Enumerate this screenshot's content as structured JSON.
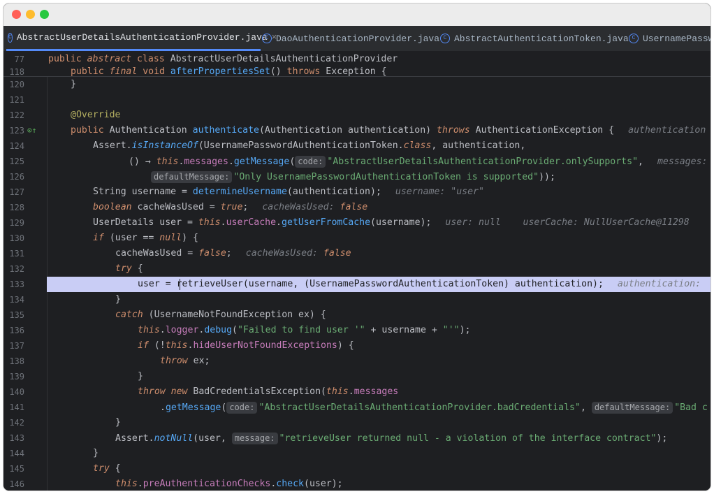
{
  "tabs": [
    {
      "label": "AbstractUserDetailsAuthenticationProvider.java",
      "active": true,
      "closable": true
    },
    {
      "label": "DaoAuthenticationProvider.java",
      "active": false
    },
    {
      "label": "AbstractAuthenticationToken.java",
      "active": false
    },
    {
      "label": "UsernamePasswo",
      "active": false
    }
  ],
  "colors": {
    "accent": "#548af7",
    "current_line": "#c9cdf5",
    "keyword": "#cf8e6d",
    "string": "#6aab73",
    "method": "#56a8f5",
    "field": "#c77dbb"
  },
  "sticky": {
    "line1_num": "77",
    "line1_text": "public abstract class AbstractUserDetailsAuthenticationProvider",
    "line2_num": "118",
    "line2_text": "public final void afterPropertiesSet() throws Exception {"
  },
  "lines": [
    {
      "num": "120"
    },
    {
      "num": "121"
    },
    {
      "num": "122"
    },
    {
      "num": "123"
    },
    {
      "num": "124"
    },
    {
      "num": "125"
    },
    {
      "num": "126"
    },
    {
      "num": "127"
    },
    {
      "num": "128"
    },
    {
      "num": "129"
    },
    {
      "num": "130"
    },
    {
      "num": "131"
    },
    {
      "num": "132"
    },
    {
      "num": "133"
    },
    {
      "num": "134"
    },
    {
      "num": "135"
    },
    {
      "num": "136"
    },
    {
      "num": "137"
    },
    {
      "num": "138"
    },
    {
      "num": "139"
    },
    {
      "num": "140"
    },
    {
      "num": "141"
    },
    {
      "num": "142"
    },
    {
      "num": "143"
    },
    {
      "num": "144"
    },
    {
      "num": "145"
    },
    {
      "num": "146"
    }
  ],
  "code": {
    "l120": "}",
    "l122_ann": "@Override",
    "l123_a": "public ",
    "l123_b": "Authentication ",
    "l123_fn": "authenticate",
    "l123_c": "(Authentication ",
    "l123_p": "authentication",
    "l123_d": ") ",
    "l123_kw": "throws ",
    "l123_e": "AuthenticationException {",
    "l123_hint": "authentication",
    "l124_a": "Assert.",
    "l124_fn": "isInstanceOf",
    "l124_b": "(UsernamePasswordAuthenticationToken.",
    "l124_kw": "class",
    "l124_c": ", authentication,",
    "l125_a": "() → ",
    "l125_kw": "this",
    "l125_b": ".",
    "l125_fld": "messages",
    "l125_c": ".",
    "l125_fn": "getMessage",
    "l125_d": "(",
    "l125_pn": "code:",
    "l125_str": "\"AbstractUserDetailsAuthenticationProvider.onlySupports\"",
    "l125_e": ",",
    "l125_hint": "messages: Me",
    "l126_pn": "defaultMessage:",
    "l126_str": "\"Only UsernamePasswordAuthenticationToken is supported\"",
    "l126_a": "));",
    "l127_a": "String username = ",
    "l127_fn": "determineUsername",
    "l127_b": "(authentication);",
    "l127_hint": "username: \"user\"",
    "l128_kw": "boolean ",
    "l128_a": "cacheWasUsed = ",
    "l128_kw2": "true",
    "l128_b": ";",
    "l128_hint": "cacheWasUsed: ",
    "l128_hintv": "false",
    "l129_a": "UserDetails user = ",
    "l129_kw": "this",
    "l129_b": ".",
    "l129_fld": "userCache",
    "l129_c": ".",
    "l129_fn": "getUserFromCache",
    "l129_d": "(username);",
    "l129_hint": "user: null    userCache: NullUserCache@11298",
    "l130_kw": "if ",
    "l130_a": "(user == ",
    "l130_kw2": "null",
    "l130_b": ") {",
    "l131_a": "cacheWasUsed = ",
    "l131_kw": "false",
    "l131_b": ";",
    "l131_hint": "cacheWasUsed: ",
    "l131_hintv": "false",
    "l132_kw": "try ",
    "l132_a": "{",
    "l133_a": "user = retrieveUser(username, (UsernamePasswordAuthenticationToken) authentication);",
    "l133_hint": "authentication:",
    "l134": "}",
    "l135_kw": "catch ",
    "l135_a": "(UsernameNotFoundException ex) {",
    "l136_kw": "this",
    "l136_a": ".",
    "l136_fld": "logger",
    "l136_b": ".",
    "l136_fn": "debug",
    "l136_c": "(",
    "l136_str": "\"Failed to find user '\"",
    "l136_d": " + username + ",
    "l136_str2": "\"'\"",
    "l136_e": ");",
    "l137_kw": "if ",
    "l137_a": "(!",
    "l137_kw2": "this",
    "l137_b": ".",
    "l137_fld": "hideUserNotFoundExceptions",
    "l137_c": ") {",
    "l138_kw": "throw ",
    "l138_a": "ex;",
    "l139": "}",
    "l140_kw": "throw new ",
    "l140_a": "BadCredentialsException(",
    "l140_kw2": "this",
    "l140_b": ".",
    "l140_fld": "messages",
    "l141_a": ".",
    "l141_fn": "getMessage",
    "l141_b": "(",
    "l141_pn": "code:",
    "l141_str": "\"AbstractUserDetailsAuthenticationProvider.badCredentials\"",
    "l141_c": ", ",
    "l141_pn2": "defaultMessage:",
    "l141_str2": "\"Bad c",
    "l142": "}",
    "l143_a": "Assert.",
    "l143_fn": "notNull",
    "l143_b": "(user, ",
    "l143_pn": "message:",
    "l143_str": "\"retrieveUser returned null - a violation of the interface contract\"",
    "l143_c": ");",
    "l144": "}",
    "l145_kw": "try ",
    "l145_a": "{",
    "l146_kw": "this",
    "l146_a": ".",
    "l146_fld": "preAuthenticationChecks",
    "l146_b": ".",
    "l146_fn": "check",
    "l146_c": "(user);"
  }
}
